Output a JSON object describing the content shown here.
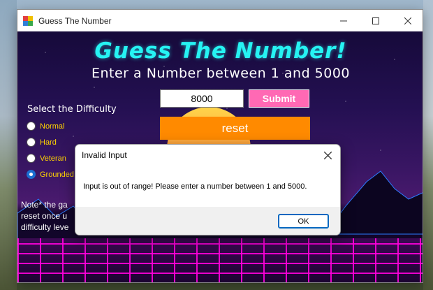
{
  "window": {
    "title": "Guess The Number"
  },
  "game": {
    "heading": "Guess The Number!",
    "subheading": "Enter a Number between 1 and 5000",
    "difficulty_label": "Select the Difficulty",
    "difficulties": [
      {
        "label": "Normal",
        "checked": false
      },
      {
        "label": "Hard",
        "checked": false
      },
      {
        "label": "Veteran",
        "checked": false
      },
      {
        "label": "Grounded",
        "checked": true
      }
    ],
    "number_value": "8000",
    "submit_label": "Submit",
    "reset_label": "reset",
    "note_lines": [
      "Note* the ga",
      "reset once u",
      "difficulty leve"
    ]
  },
  "dialog": {
    "title": "Invalid Input",
    "message": "Input is out of range! Please enter a number between 1 and 5000.",
    "ok_label": "OK"
  },
  "colors": {
    "heading": "#26f3f3",
    "submit": "#ff69b4",
    "reset": "#ff8a00",
    "radio_text": "#ffd400"
  },
  "icons": {
    "app": "app-icon",
    "minimize": "minimize-icon",
    "maximize": "maximize-icon",
    "close": "close-icon",
    "dialog_close": "close-icon"
  }
}
